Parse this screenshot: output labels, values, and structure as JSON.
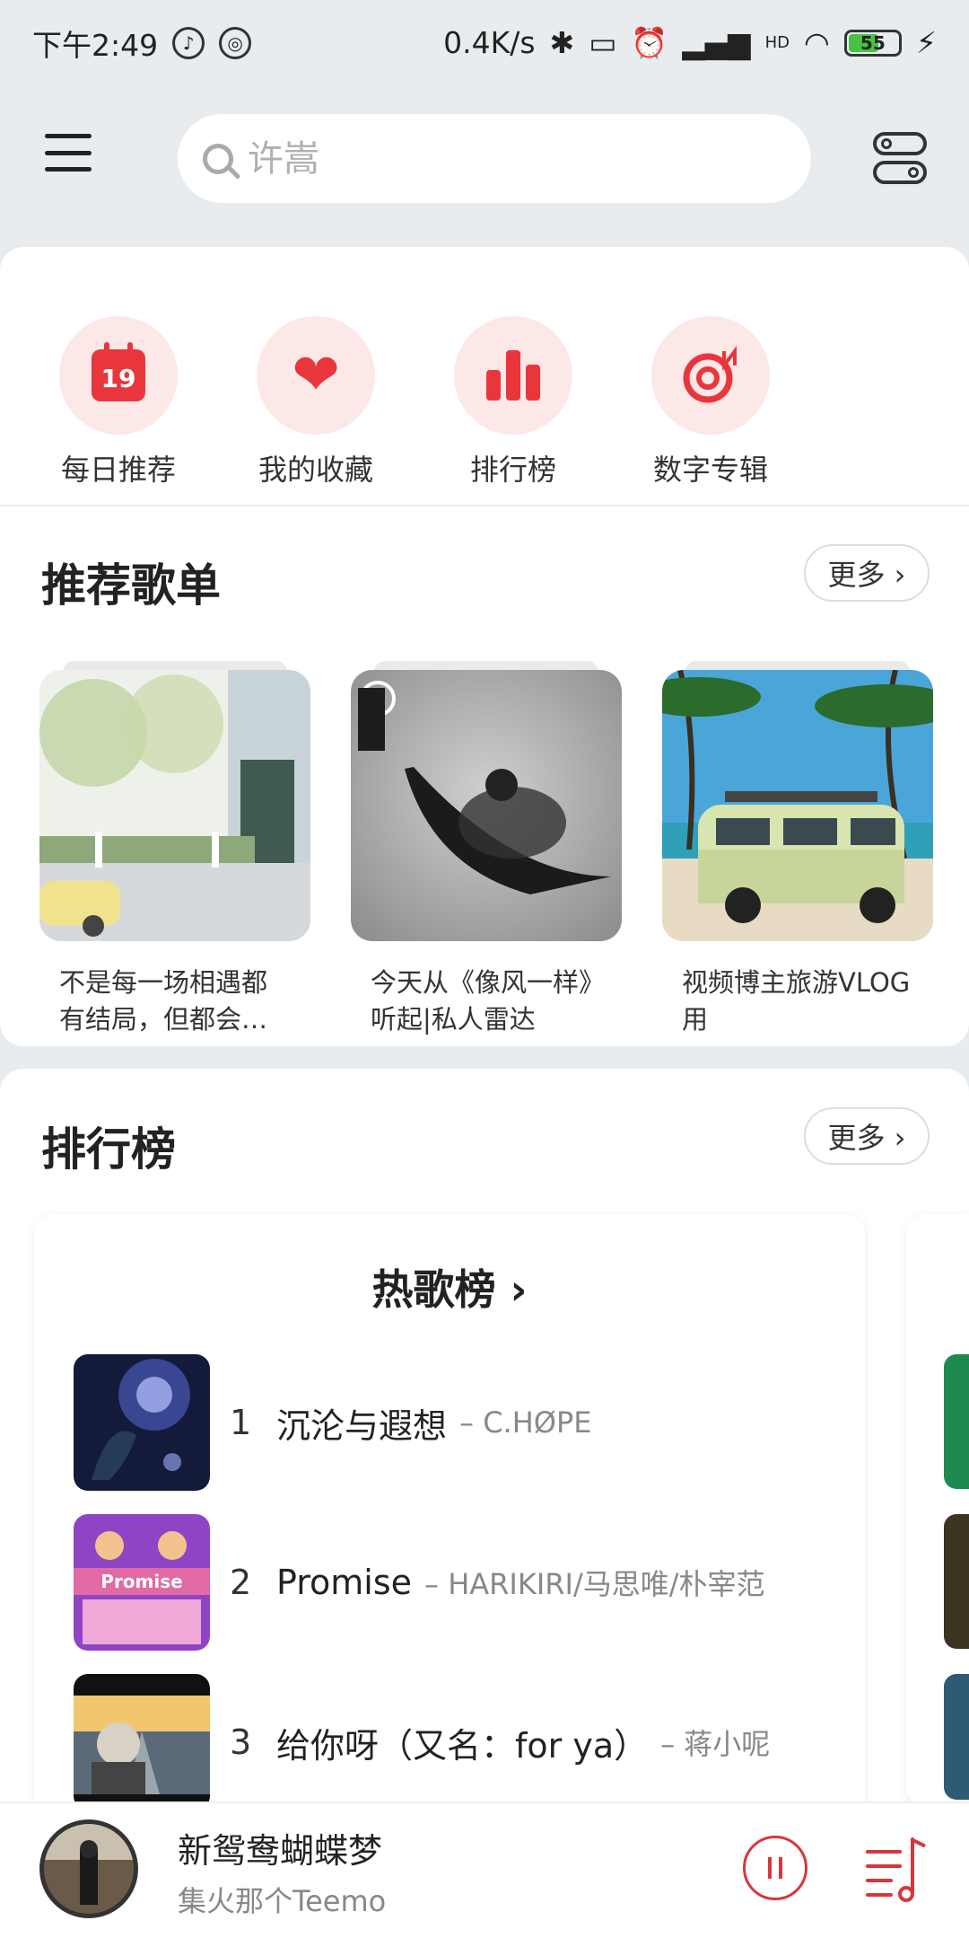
{
  "status_bar": {
    "time": "下午2:49",
    "speed": "0.4K/s",
    "hd": "HD",
    "battery": "55"
  },
  "search": {
    "placeholder": "许嵩"
  },
  "quick_actions": [
    {
      "label": "每日推荐",
      "icon": "calendar-icon",
      "day": "19"
    },
    {
      "label": "我的收藏",
      "icon": "heart-icon"
    },
    {
      "label": "排行榜",
      "icon": "bar-chart-icon"
    },
    {
      "label": "数字专辑",
      "icon": "digital-album-icon"
    }
  ],
  "recommend": {
    "title": "推荐歌单",
    "more": "更多 ›",
    "playlists": [
      {
        "caption": "不是每一场相遇都有结局，但都会…"
      },
      {
        "caption": "今天从《像风一样》听起|私人雷达"
      },
      {
        "caption": "视频博主旅游VLOG用"
      }
    ]
  },
  "charts": {
    "title": "排行榜",
    "more": "更多 ›",
    "card_title": "热歌榜 ›",
    "songs": [
      {
        "rank": "1",
        "name": "沉沦与遐想",
        "artist": "– C.HØPE"
      },
      {
        "rank": "2",
        "name": "Promise",
        "artist": "– HARIKIRI/马思唯/朴宰范"
      },
      {
        "rank": "3",
        "name": "给你呀（又名：for ya）",
        "artist": "– 蒋小呢"
      }
    ]
  },
  "player": {
    "title": "新鸳鸯蝴蝶梦",
    "artist": "集火那个Teemo"
  },
  "colors": {
    "accent": "#e8363c",
    "accent_light": "#fde8e8"
  }
}
